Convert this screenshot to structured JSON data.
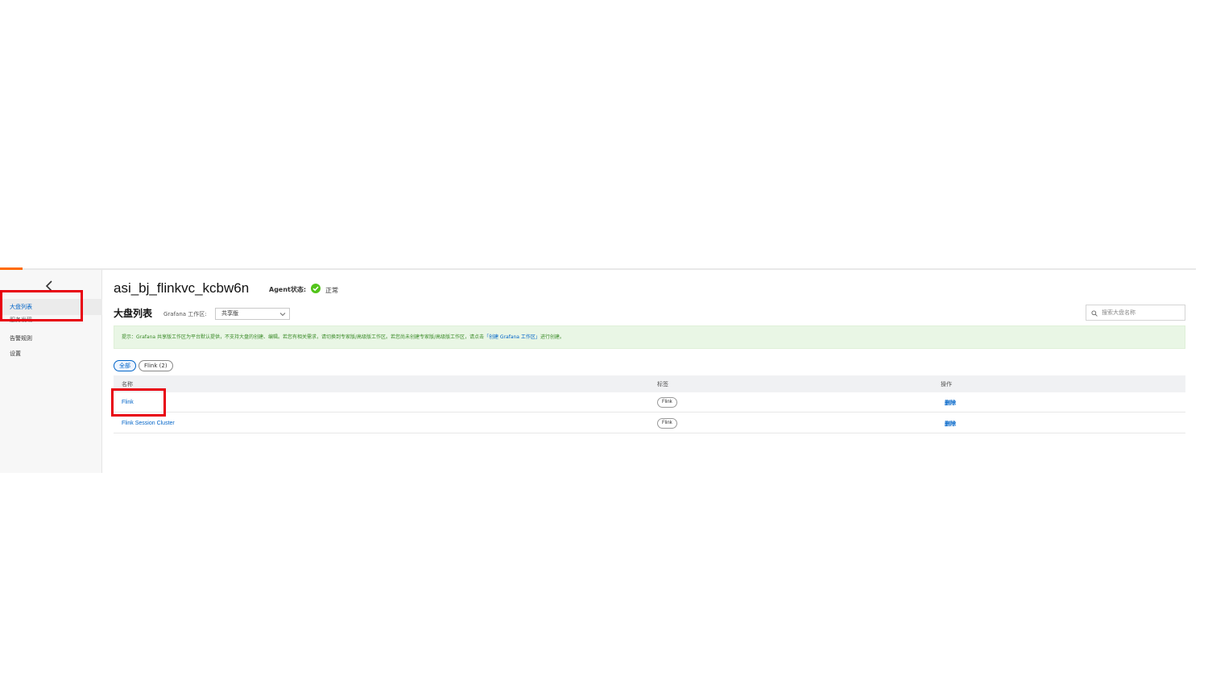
{
  "sidebar": {
    "items": [
      {
        "label": "大盘列表",
        "active": true
      },
      {
        "label": "服务发现",
        "active": false
      },
      {
        "label": "告警规则",
        "active": false
      },
      {
        "label": "设置",
        "active": false
      }
    ]
  },
  "header": {
    "title": "asi_bj_flinkvc_kcbw6n",
    "agent_label": "Agent状态:",
    "agent_status": "正常"
  },
  "section": {
    "title": "大盘列表",
    "workspace_label": "Grafana 工作区:",
    "workspace_value": "共享版"
  },
  "search": {
    "placeholder": "搜索大盘名称",
    "value": ""
  },
  "tip": {
    "text_before": "提示：Grafana 共享版工作区为平台默认提供，不支持大盘的创建、编辑。若您有相关需求，请切换到专家版/高级版工作区。若您尚未创建专家版/高级版工作区，请点击",
    "link": "「创建 Grafana 工作区」",
    "text_after": "进行创建。"
  },
  "filters": [
    {
      "label": "全部",
      "active": true
    },
    {
      "label": "Flink (2)",
      "active": false
    }
  ],
  "table": {
    "columns": [
      "名称",
      "标签",
      "操作"
    ],
    "rows": [
      {
        "name": "Flink",
        "tag": "Flink",
        "action": "删除"
      },
      {
        "name": "Flink Session Cluster",
        "tag": "Flink",
        "action": "删除"
      }
    ]
  },
  "colors": {
    "accent": "#0064c8",
    "brand": "#ff6a00",
    "success": "#52c41a",
    "highlight": "#e8000f",
    "tip_background": "#e9f6e5"
  }
}
